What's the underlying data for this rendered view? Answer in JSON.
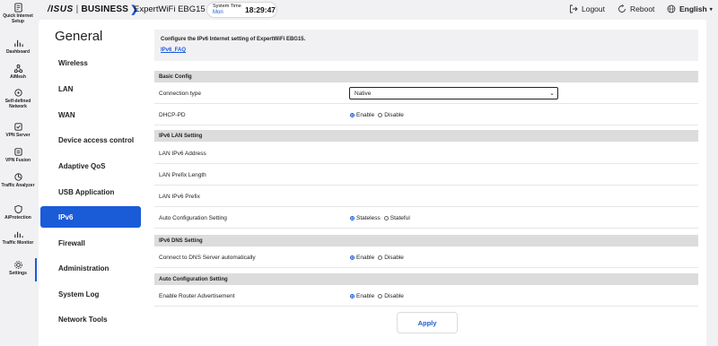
{
  "rail": [
    {
      "label": "Quick Internet Setup",
      "icon": "quick-setup-icon"
    },
    {
      "label": "Dashboard",
      "icon": "dashboard-icon"
    },
    {
      "label": "AiMesh",
      "icon": "aimesh-icon"
    },
    {
      "label": "Self-defined Network",
      "icon": "network-icon"
    },
    {
      "label": "VPN Server",
      "icon": "vpn-server-icon"
    },
    {
      "label": "VPN Fusion",
      "icon": "vpn-fusion-icon"
    },
    {
      "label": "Traffic Analyzer",
      "icon": "traffic-analyzer-icon"
    },
    {
      "label": "AiProtection",
      "icon": "aiprotection-icon"
    },
    {
      "label": "Traffic Monitor",
      "icon": "traffic-monitor-icon"
    },
    {
      "label": "Settings",
      "icon": "settings-icon"
    }
  ],
  "header": {
    "brand": "/ISUS",
    "brand_sep": "|",
    "brand_business": "BUSINESS",
    "model": "ExpertWiFi EBG15",
    "time_label": "System Time",
    "time_day": "Mon",
    "time_clock": "18:29:47",
    "logout": "Logout",
    "reboot": "Reboot",
    "language": "English"
  },
  "subnav": {
    "title": "General",
    "items": [
      "Wireless",
      "LAN",
      "WAN",
      "Device access control",
      "Adaptive QoS",
      "USB Application",
      "IPv6",
      "Firewall",
      "Administration",
      "System Log",
      "Network Tools"
    ],
    "active": "IPv6"
  },
  "main": {
    "description": "Configure the IPv6 Internet setting of ExpertWiFi EBG15.",
    "faq_link": "IPv6_FAQ",
    "sections": {
      "basic": "Basic Config",
      "lan": "IPv6 LAN Setting",
      "dns": "IPv6 DNS Setting",
      "auto": "Auto Configuration Setting"
    },
    "rows": {
      "connection_type": {
        "label": "Connection type",
        "value": "Native"
      },
      "dhcp_pd": {
        "label": "DHCP-PD",
        "opt1": "Enable",
        "opt2": "Disable"
      },
      "lan_addr": {
        "label": "LAN IPv6 Address"
      },
      "lan_prefix_len": {
        "label": "LAN Prefix Length"
      },
      "lan_prefix": {
        "label": "LAN IPv6 Prefix"
      },
      "auto_conf": {
        "label": "Auto Configuration Setting",
        "opt1": "Stateless",
        "opt2": "Stateful"
      },
      "dns_auto": {
        "label": "Connect to DNS Server automatically",
        "opt1": "Enable",
        "opt2": "Disable"
      },
      "router_adv": {
        "label": "Enable Router Advertisement",
        "opt1": "Enable",
        "opt2": "Disable"
      }
    },
    "apply": "Apply"
  },
  "colors": {
    "accent": "#1a5bd8",
    "section": "#dcdcdc",
    "background": "#f1f1f3"
  }
}
